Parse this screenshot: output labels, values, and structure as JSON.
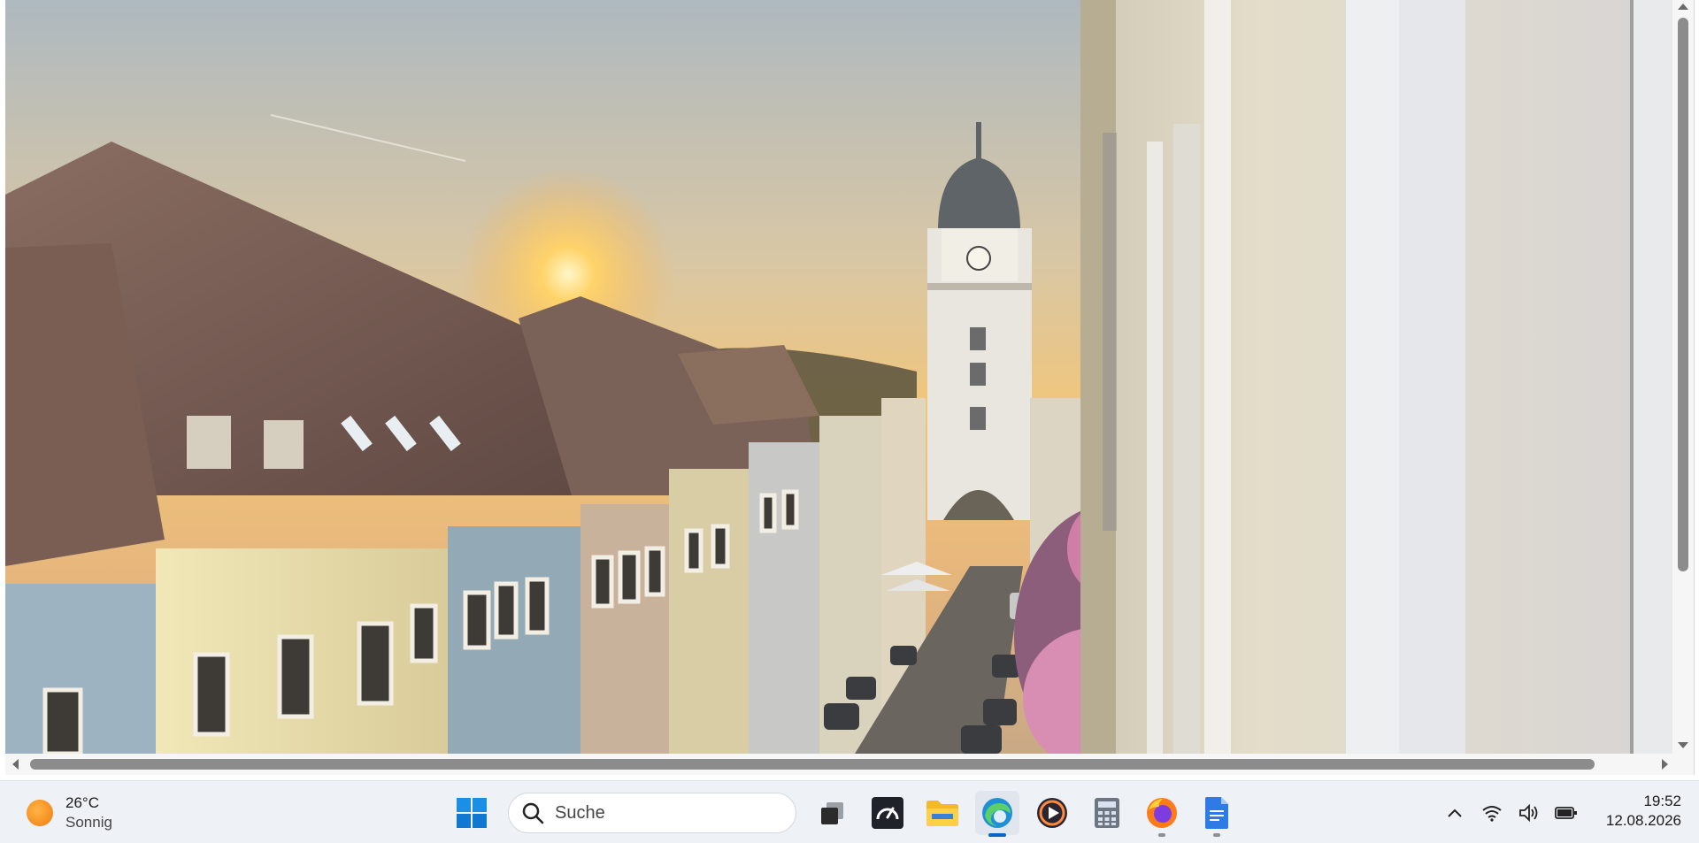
{
  "webcam": {
    "scene": "webcam-town-square-sunset"
  },
  "taskbar": {
    "weather": {
      "temperature": "26°C",
      "condition": "Sonnig",
      "icon": "sun-icon"
    },
    "search": {
      "placeholder": "Suche"
    },
    "apps": [
      {
        "name": "start-menu",
        "icon": "windows-logo-icon"
      },
      {
        "name": "task-view",
        "icon": "task-view-icon"
      },
      {
        "name": "speedtest",
        "icon": "speedometer-icon"
      },
      {
        "name": "file-explorer",
        "icon": "folder-icon"
      },
      {
        "name": "edge",
        "icon": "edge-icon",
        "active": true
      },
      {
        "name": "media-player",
        "icon": "play-icon"
      },
      {
        "name": "calculator",
        "icon": "calculator-icon"
      },
      {
        "name": "firefox",
        "icon": "firefox-icon",
        "running": true
      },
      {
        "name": "docs",
        "icon": "document-icon",
        "running": true
      }
    ],
    "tray": {
      "icons": [
        "chevron-up-icon",
        "wifi-icon",
        "speaker-icon",
        "battery-icon"
      ]
    },
    "clock": {
      "time": "19:52",
      "date": "12.08.2026"
    }
  },
  "colors": {
    "taskbar_bg": "#eef1f6",
    "accent": "#0a64c8",
    "sky_top": "#b9c3c7",
    "sun": "#ffd36a"
  }
}
